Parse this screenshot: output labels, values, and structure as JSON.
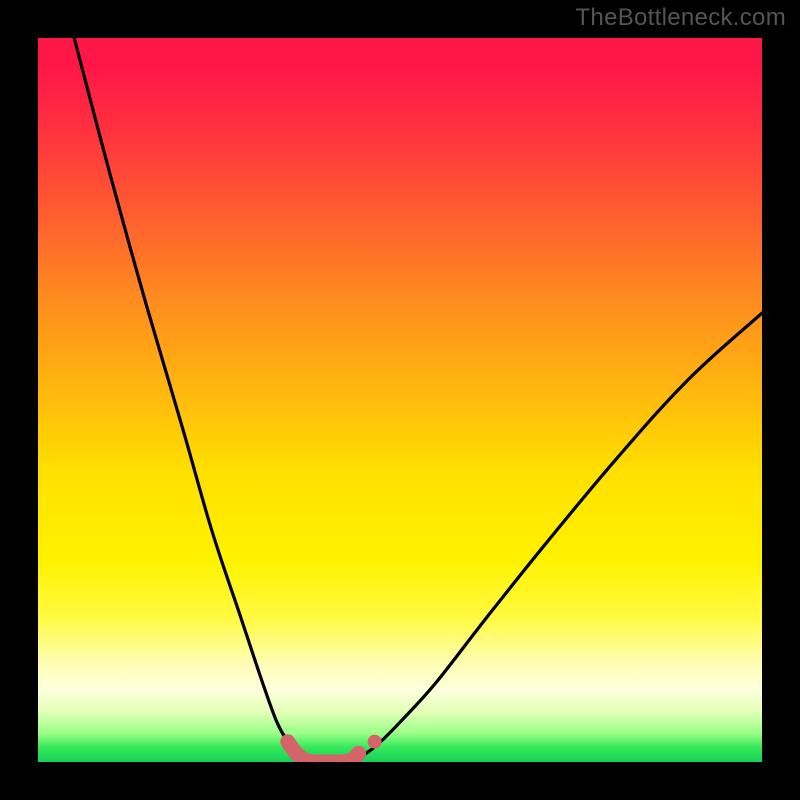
{
  "watermark": "TheBottleneck.com",
  "chart_data": {
    "type": "line",
    "title": "",
    "xlabel": "",
    "ylabel": "",
    "xlim": [
      0,
      100
    ],
    "ylim": [
      0,
      100
    ],
    "grid": false,
    "legend": false,
    "background_gradient": {
      "top_color": "#ff1748",
      "mid_color": "#ffe000",
      "bottom_color": "#18d05a"
    },
    "description": "Two smooth curves descend from opposite upper corners toward a shared valley near the bottom center, forming a V-shaped envelope. The valley floor is highlighted with a thick muted-red segment and a small detached dot on the right ascending branch.",
    "series": [
      {
        "name": "left-branch",
        "x": [
          5,
          10,
          15,
          20,
          24,
          28,
          31,
          33,
          34.5,
          35.5,
          36,
          36.5,
          37,
          37.3
        ],
        "y": [
          100,
          81,
          63,
          46,
          32,
          20,
          11,
          5.5,
          2.8,
          1.5,
          0.9,
          0.5,
          0.25,
          0.1
        ]
      },
      {
        "name": "right-branch",
        "x": [
          42.7,
          43.5,
          45,
          47,
          50,
          55,
          62,
          70,
          80,
          90,
          100
        ],
        "y": [
          0.1,
          0.3,
          1.0,
          2.5,
          5.5,
          11,
          20,
          30,
          42,
          53,
          62
        ]
      },
      {
        "name": "valley-floor-highlight",
        "x": [
          34.5,
          35.5,
          36.5,
          37.3,
          39,
          41,
          42.7,
          43.5,
          44.3
        ],
        "y": [
          2.8,
          1.4,
          0.5,
          0.1,
          0,
          0,
          0.1,
          0.4,
          1.2
        ]
      },
      {
        "name": "detached-dot",
        "x": [
          46.5
        ],
        "y": [
          2.8
        ]
      }
    ]
  }
}
